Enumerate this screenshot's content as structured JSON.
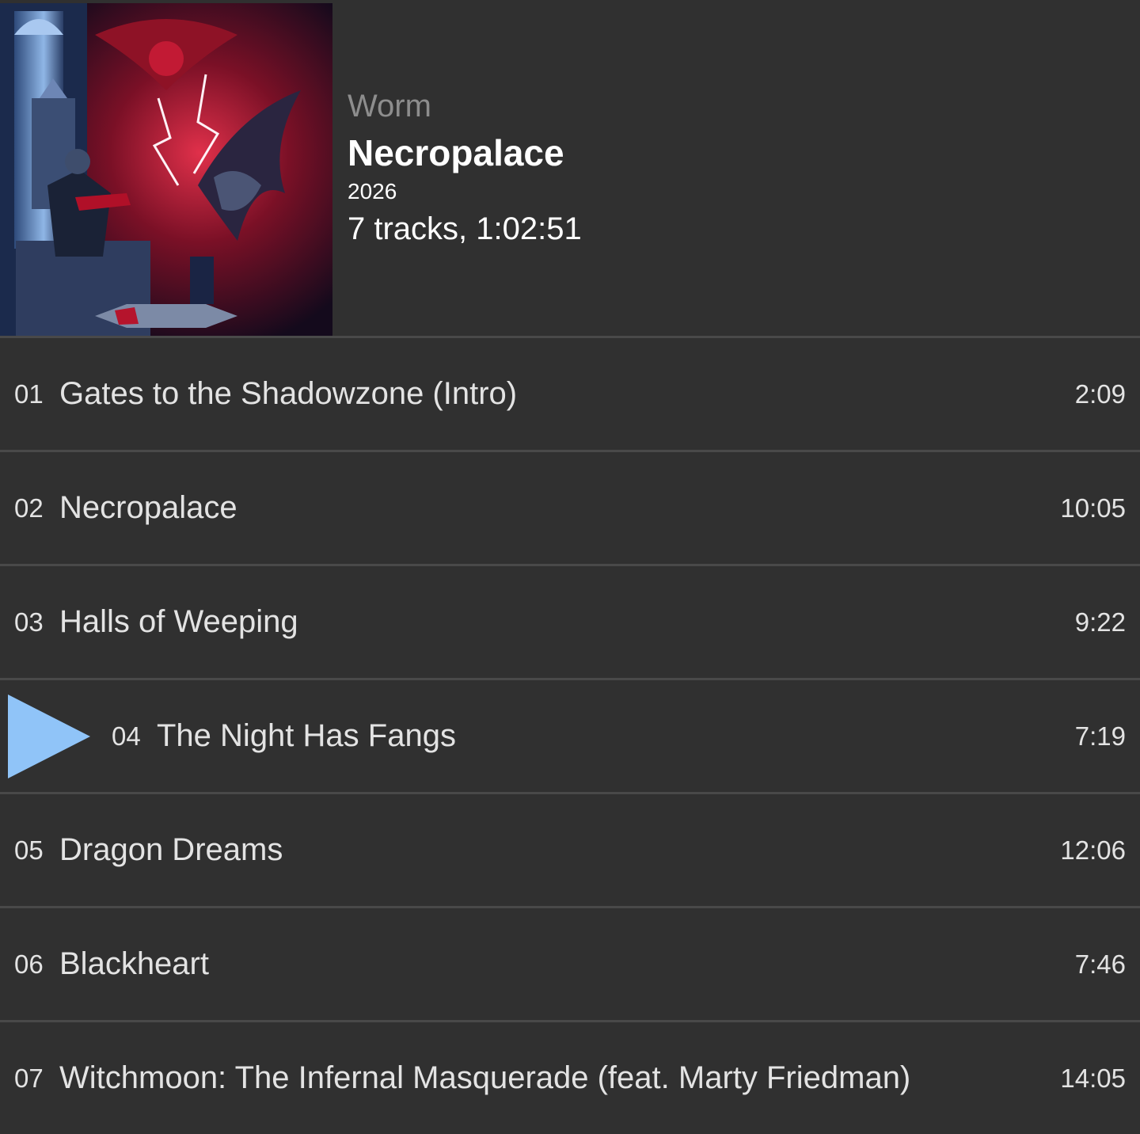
{
  "album": {
    "artist": "Worm",
    "title": "Necropalace",
    "year": "2026",
    "summary": "7 tracks, 1:02:51",
    "cover_art": "album-cover"
  },
  "player": {
    "now_playing_indicator": "play-icon",
    "indicator_color": "#90c4f8",
    "playing_index": 3
  },
  "tracks": [
    {
      "num": "01",
      "title": "Gates to the Shadowzone (Intro)",
      "duration": "2:09"
    },
    {
      "num": "02",
      "title": "Necropalace",
      "duration": "10:05"
    },
    {
      "num": "03",
      "title": "Halls of Weeping",
      "duration": "9:22"
    },
    {
      "num": "04",
      "title": "The Night Has Fangs",
      "duration": "7:19"
    },
    {
      "num": "05",
      "title": "Dragon Dreams",
      "duration": "12:06"
    },
    {
      "num": "06",
      "title": "Blackheart",
      "duration": "7:46"
    },
    {
      "num": "07",
      "title": "Witchmoon: The Infernal Masquerade (feat. Marty Friedman)",
      "duration": "14:05"
    }
  ]
}
